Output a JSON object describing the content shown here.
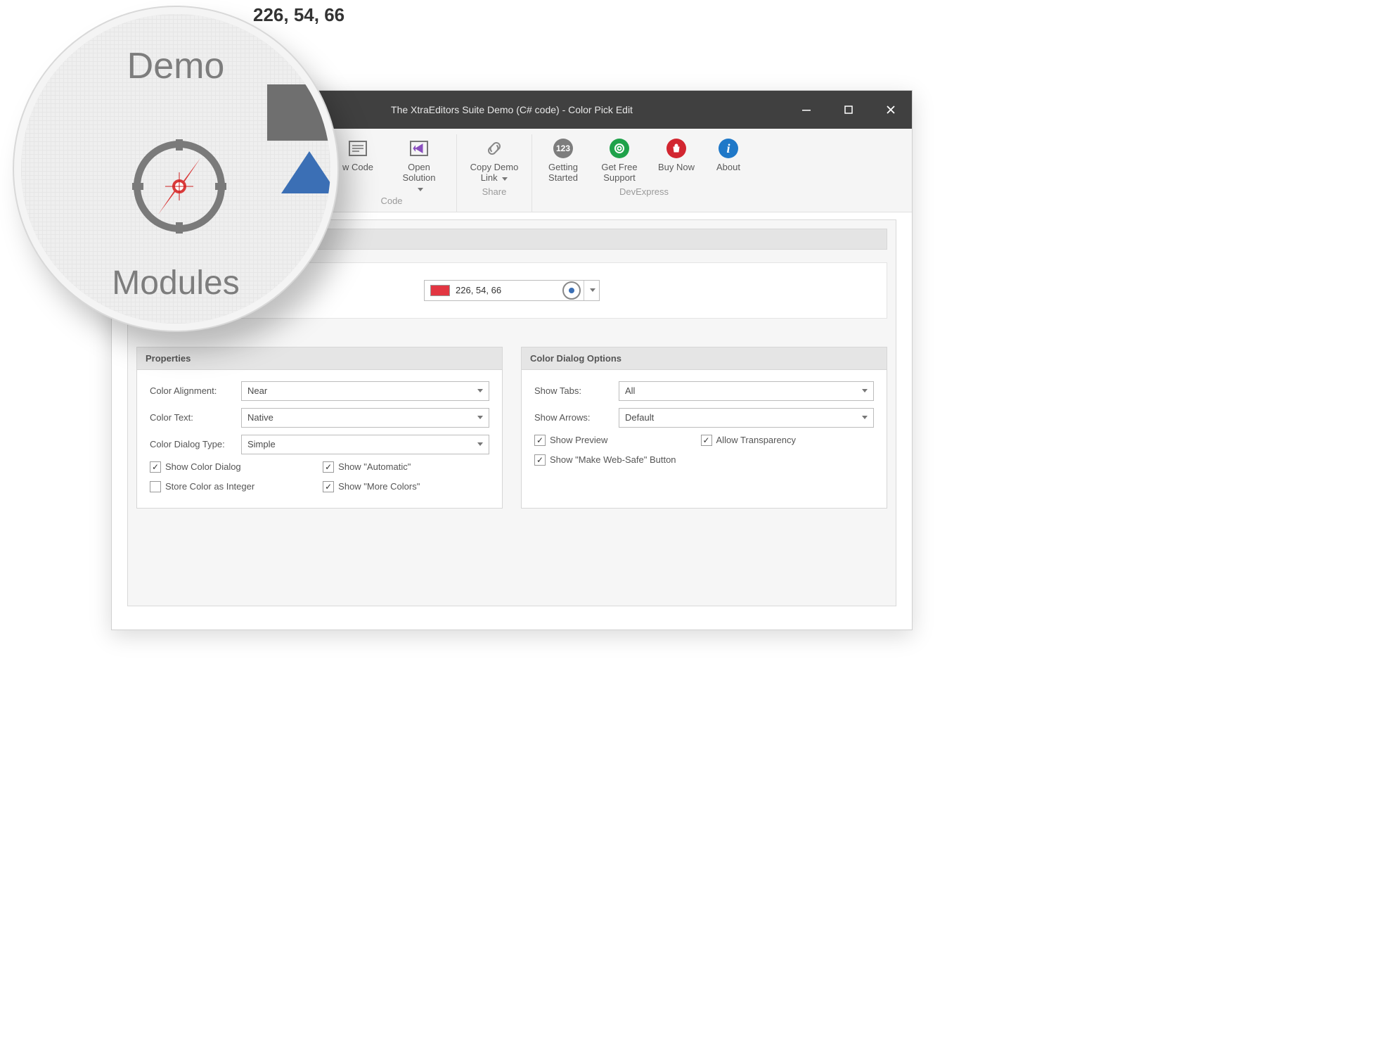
{
  "zoom_label": "226, 54, 66",
  "magnifier": {
    "text_top": "Demo",
    "text_bottom": "Modules"
  },
  "window": {
    "title": "The XtraEditors Suite Demo (C# code) - Color Pick Edit"
  },
  "ribbon": {
    "groups": [
      {
        "name": "Code",
        "items": [
          {
            "id": "view-code",
            "label": "w Code",
            "label_full": "View Code",
            "icon": "code"
          },
          {
            "id": "open-solution",
            "label": "Open Solution",
            "icon": "vs",
            "dropdown": true
          }
        ]
      },
      {
        "name": "Share",
        "items": [
          {
            "id": "copy-demo-link",
            "label": "Copy Demo Link",
            "icon": "link",
            "dropdown": true
          }
        ]
      },
      {
        "name": "DevExpress",
        "items": [
          {
            "id": "getting-started",
            "label": "Getting Started",
            "icon": "123"
          },
          {
            "id": "get-free-support",
            "label": "Get Free Support",
            "icon": "lifebuoy"
          },
          {
            "id": "buy-now",
            "label": "Buy Now",
            "icon": "bag"
          },
          {
            "id": "about",
            "label": "About",
            "icon": "info"
          }
        ]
      }
    ]
  },
  "colorpick": {
    "value": "226, 54, 66",
    "swatch_hex": "#e23642"
  },
  "panel_properties": {
    "title": "Properties",
    "fields": {
      "color_alignment": {
        "label": "Color Alignment:",
        "value": "Near"
      },
      "color_text": {
        "label": "Color Text:",
        "value": "Native"
      },
      "color_dialog_type": {
        "label": "Color Dialog Type:",
        "value": "Simple"
      }
    },
    "checks": {
      "show_color_dialog": {
        "label": "Show Color Dialog",
        "checked": true
      },
      "show_automatic": {
        "label": "Show \"Automatic\"",
        "checked": true
      },
      "store_color_integer": {
        "label": "Store Color as Integer",
        "checked": false
      },
      "show_more_colors": {
        "label": "Show \"More Colors\"",
        "checked": true
      }
    }
  },
  "panel_dialog": {
    "title": "Color Dialog Options",
    "fields": {
      "show_tabs": {
        "label": "Show Tabs:",
        "value": "All"
      },
      "show_arrows": {
        "label": "Show Arrows:",
        "value": "Default"
      }
    },
    "checks": {
      "show_preview": {
        "label": "Show Preview",
        "checked": true
      },
      "allow_transparency": {
        "label": "Allow Transparency",
        "checked": true
      },
      "show_websafe": {
        "label": "Show \"Make Web-Safe\" Button",
        "checked": true
      }
    }
  }
}
